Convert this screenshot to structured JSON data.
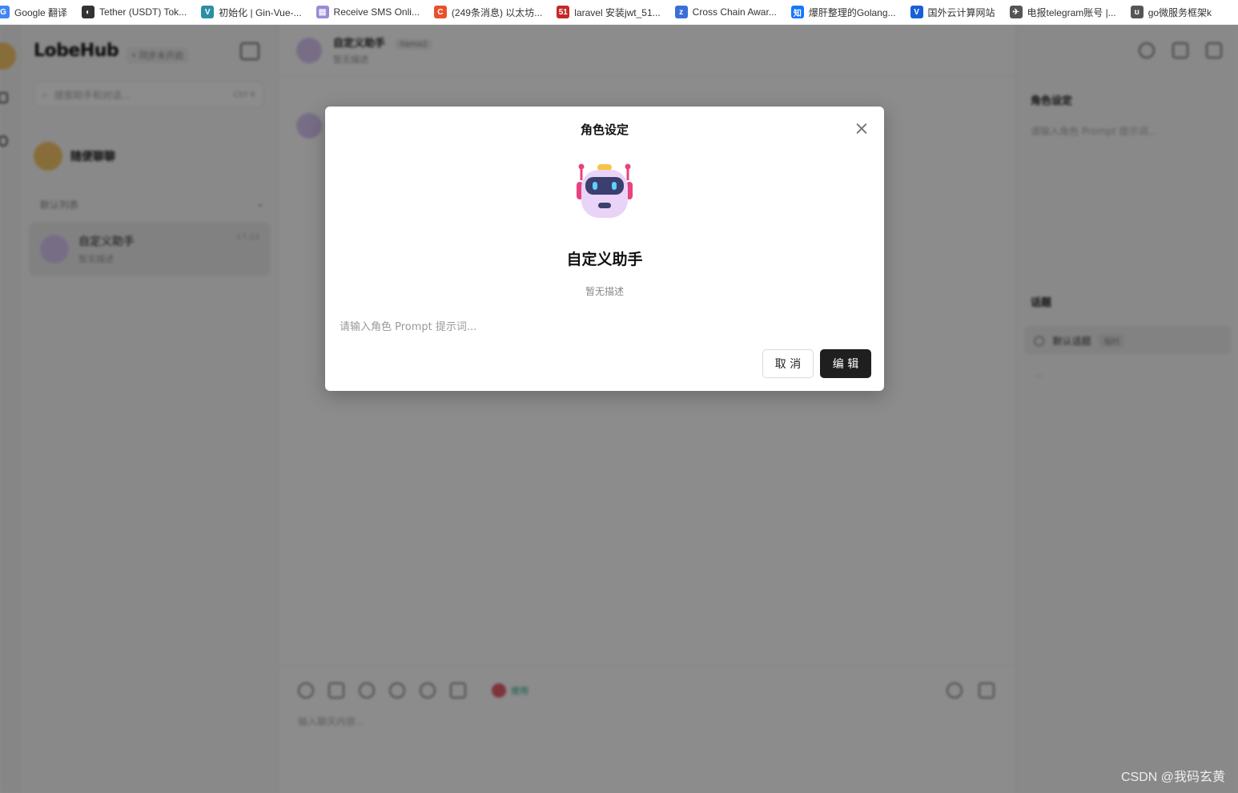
{
  "bookmarks": [
    {
      "label": "Google 翻译",
      "color": "#4285f4",
      "glyph": "G"
    },
    {
      "label": "Tether (USDT) Tok...",
      "color": "#333333",
      "glyph": "◐"
    },
    {
      "label": "初始化 | Gin-Vue-...",
      "color": "#2c8ea3",
      "glyph": "V"
    },
    {
      "label": "Receive SMS Onli...",
      "color": "#9b8bd6",
      "glyph": "▤"
    },
    {
      "label": "(249条消息) 以太坊...",
      "color": "#e8502f",
      "glyph": "C"
    },
    {
      "label": "laravel 安装jwt_51...",
      "color": "#c62828",
      "glyph": "51"
    },
    {
      "label": "Cross Chain Awar...",
      "color": "#3b6fd8",
      "glyph": "z"
    },
    {
      "label": "爆肝整理的Golang...",
      "color": "#1677ff",
      "glyph": "知"
    },
    {
      "label": "国外云计算网站",
      "color": "#1a5fd8",
      "glyph": "V"
    },
    {
      "label": "电报telegram账号 |...",
      "color": "#555555",
      "glyph": "✈"
    },
    {
      "label": "go微服务框架k",
      "color": "#555555",
      "glyph": "ʊ"
    }
  ],
  "sessions": {
    "brand": "LobeHub",
    "brand_tag": "• 同步未开启",
    "search_placeholder": "搜索助手和对话...",
    "search_kbd": "Ctrl K",
    "inbox_label": "随便聊聊",
    "group_title": "默认列表",
    "item": {
      "title": "自定义助手",
      "desc": "暂无描述",
      "time": "17:23"
    }
  },
  "chat": {
    "title": "自定义助手",
    "model": "llama2",
    "desc": "暂无描述",
    "tokens_label": "使用",
    "input_placeholder": "输入聊天内容..."
  },
  "panel": {
    "role_title": "角色设定",
    "role_placeholder": "请输入角色 Prompt 提示词...",
    "topics_title": "话题",
    "topic_item": "默认话题",
    "topic_badge": "临时",
    "topic_more": "..."
  },
  "modal": {
    "title": "角色设定",
    "name": "自定义助手",
    "desc": "暂无描述",
    "prompt_placeholder": "请输入角色 Prompt 提示词...",
    "cancel_label": "取 消",
    "edit_label": "编 辑"
  },
  "watermark": "CSDN @我码玄黄"
}
